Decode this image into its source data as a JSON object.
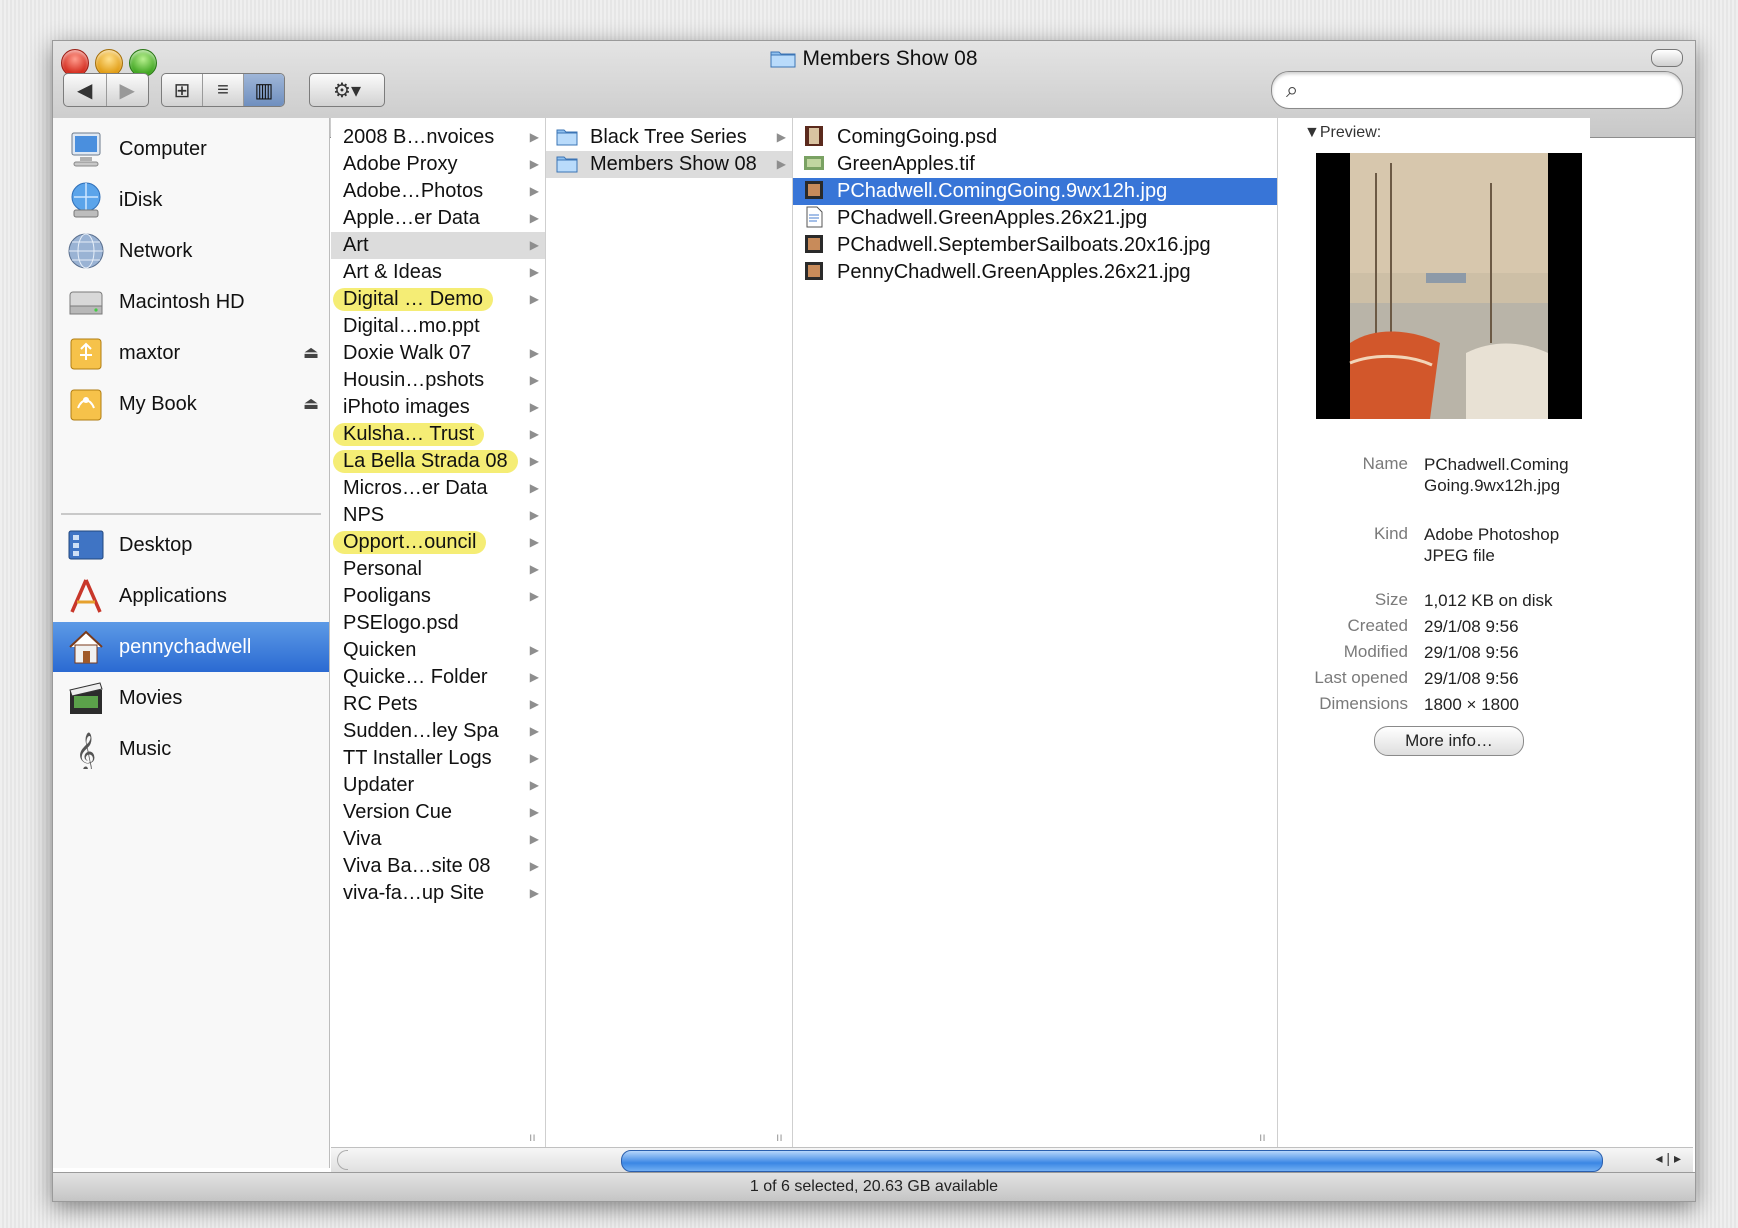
{
  "window": {
    "title": "Members Show 08",
    "status": "1 of 6 selected, 20.63 GB available"
  },
  "toolbar": {
    "back": "◀",
    "forward": "▶",
    "view_icons": "⊞",
    "view_list": "≡",
    "view_columns": "▥",
    "action": "⚙▾",
    "search_placeholder": ""
  },
  "sidebar": {
    "devices": [
      {
        "label": "Computer",
        "icon": "computer-icon"
      },
      {
        "label": "iDisk",
        "icon": "idisk-icon"
      },
      {
        "label": "Network",
        "icon": "network-icon"
      },
      {
        "label": "Macintosh HD",
        "icon": "hard-drive-icon"
      },
      {
        "label": "maxtor",
        "icon": "usb-drive-icon",
        "eject": "⏏"
      },
      {
        "label": "My Book",
        "icon": "firewire-drive-icon",
        "eject": "⏏"
      }
    ],
    "places": [
      {
        "label": "Desktop",
        "icon": "desktop-icon"
      },
      {
        "label": "Applications",
        "icon": "applications-icon"
      },
      {
        "label": "pennychadwell",
        "icon": "home-icon",
        "selected": true
      },
      {
        "label": "Movies",
        "icon": "movies-icon"
      },
      {
        "label": "Music",
        "icon": "music-icon"
      }
    ]
  },
  "column1": {
    "items": [
      {
        "label": "2008 B…nvoices",
        "arrow": true
      },
      {
        "label": "Adobe Proxy",
        "arrow": true
      },
      {
        "label": "Adobe…Photos",
        "arrow": true
      },
      {
        "label": "Apple…er Data",
        "arrow": true
      },
      {
        "label": "Art",
        "arrow": true,
        "selected": "gray"
      },
      {
        "label": "Art & Ideas",
        "arrow": true
      },
      {
        "label": "Digital … Demo",
        "arrow": true,
        "tag": "yellow"
      },
      {
        "label": "Digital…mo.ppt",
        "arrow": false
      },
      {
        "label": "Doxie Walk 07",
        "arrow": true
      },
      {
        "label": "Housin…pshots",
        "arrow": true
      },
      {
        "label": "iPhoto images",
        "arrow": true
      },
      {
        "label": "Kulsha… Trust",
        "arrow": true,
        "tag": "yellow"
      },
      {
        "label": "La Bella Strada 08",
        "arrow": true,
        "tag": "yellow"
      },
      {
        "label": "Micros…er Data",
        "arrow": true
      },
      {
        "label": "NPS",
        "arrow": true
      },
      {
        "label": "Opport…ouncil",
        "arrow": true,
        "tag": "yellow"
      },
      {
        "label": "Personal",
        "arrow": true
      },
      {
        "label": "Pooligans",
        "arrow": true
      },
      {
        "label": "PSElogo.psd",
        "arrow": false
      },
      {
        "label": "Quicken",
        "arrow": true
      },
      {
        "label": "Quicke… Folder",
        "arrow": true
      },
      {
        "label": "RC Pets",
        "arrow": true
      },
      {
        "label": "Sudden…ley Spa",
        "arrow": true
      },
      {
        "label": "TT Installer Logs",
        "arrow": true
      },
      {
        "label": "Updater",
        "arrow": true
      },
      {
        "label": "Version Cue",
        "arrow": true
      },
      {
        "label": "Viva",
        "arrow": true
      },
      {
        "label": "Viva Ba…site 08",
        "arrow": true
      },
      {
        "label": "viva-fa…up Site",
        "arrow": true
      }
    ]
  },
  "column2": {
    "items": [
      {
        "label": "Black Tree Series",
        "arrow": true
      },
      {
        "label": "Members Show 08",
        "arrow": true,
        "selected": "gray"
      }
    ]
  },
  "column3": {
    "items": [
      {
        "label": "ComingGoing.psd",
        "icon": "psd-file-icon"
      },
      {
        "label": "GreenApples.tif",
        "icon": "tif-file-icon"
      },
      {
        "label": "PChadwell.ComingGoing.9wx12h.jpg",
        "icon": "jpg-file-icon",
        "selected": "blue"
      },
      {
        "label": "PChadwell.GreenApples.26x21.jpg",
        "icon": "document-file-icon"
      },
      {
        "label": "PChadwell.SeptemberSailboats.20x16.jpg",
        "icon": "jpg-file-icon"
      },
      {
        "label": "PennyChadwell.GreenApples.26x21.jpg",
        "icon": "jpg-file-icon"
      }
    ]
  },
  "preview": {
    "heading": "▼Preview:",
    "fields": [
      {
        "key": "Name",
        "value": "PChadwell.ComingGoing.9wx12h.jpg"
      },
      {
        "key": "Kind",
        "value": "Adobe Photoshop JPEG file"
      },
      {
        "key": "Size",
        "value": "1,012 KB on disk"
      },
      {
        "key": "Created",
        "value": "29/1/08 9:56"
      },
      {
        "key": "Modified",
        "value": "29/1/08 9:56"
      },
      {
        "key": "Last opened",
        "value": "29/1/08 9:56"
      },
      {
        "key": "Dimensions",
        "value": "1800 × 1800"
      }
    ],
    "more_button": "More info…"
  },
  "colors": {
    "selection_blue": "#3875d7",
    "sidebar_selected": "#2b6ad2",
    "label_yellow": "#f5ed75"
  }
}
